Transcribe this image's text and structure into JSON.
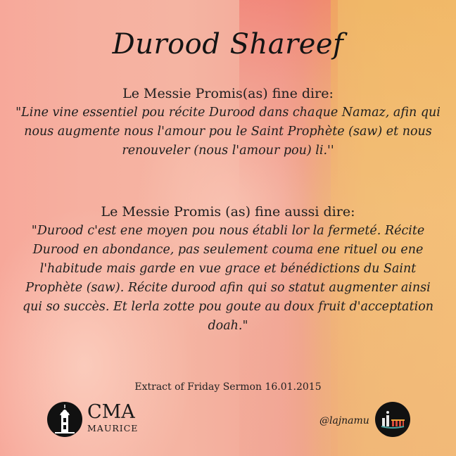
{
  "title": "Durood Shareef",
  "section1": {
    "heading": "Le Messie Promis(as) fine dire:",
    "quote": "\"Line vine essentiel pou récite Durood dans chaque Namaz, afin qui nous augmente nous l'amour pou le Saint Prophète (saw) et nous renouveler (nous l'amour pou) li.''"
  },
  "section2": {
    "heading": "Le Messie Promis (as) fine aussi dire:",
    "quote": "\"Durood c'est ene moyen pou nous établi lor la fermeté. Récite Durood en abondance, pas seulement couma ene rituel ou ene l'habitude mais garde en vue grace et bénédictions du Saint Prophète (saw). Récite durood afin qui so statut augmenter ainsi qui so succès. Et lerla zotte pou goute au doux fruit d'acceptation doah.\""
  },
  "source": "Extract of Friday Sermon 16.01.2015",
  "cma": {
    "name": "CMA",
    "subtitle": "MAURICE",
    "icon": "mosque-minaret-icon"
  },
  "lajna": {
    "handle": "@lajnamu",
    "icon": "lajna-logo-icon"
  },
  "colors": {
    "text": "#1a1a1a",
    "bg_left": "#f6b0a0",
    "bg_right": "#f3c07d"
  }
}
